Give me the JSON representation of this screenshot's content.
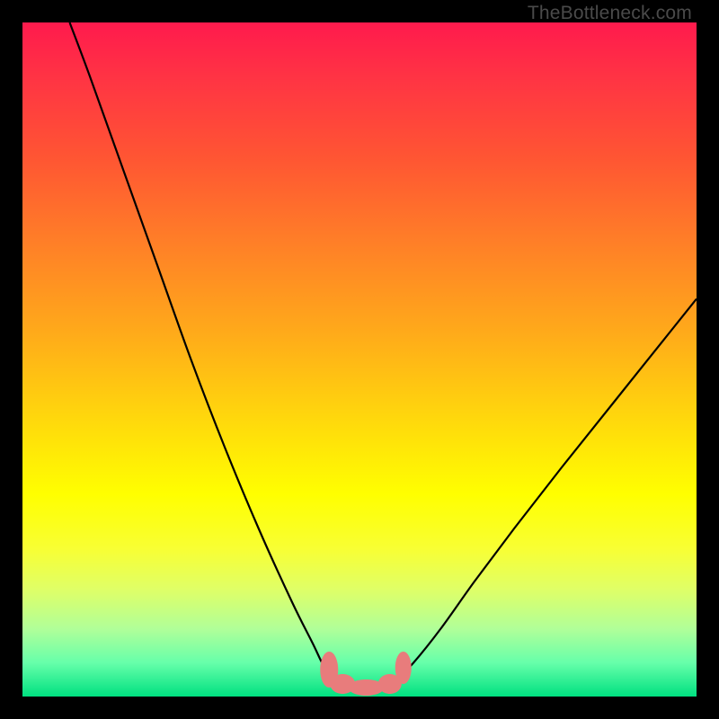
{
  "watermark": "TheBottleneck.com",
  "colors": {
    "frame": "#000000",
    "curve": "#000000",
    "blob": "#e87c7c",
    "gradient_top": "#ff1a4d",
    "gradient_bottom": "#00e080"
  },
  "chart_data": {
    "type": "line",
    "title": "",
    "xlabel": "",
    "ylabel": "",
    "xlim": [
      0,
      100
    ],
    "ylim": [
      0,
      100
    ],
    "series": [
      {
        "name": "left-curve",
        "x": [
          7,
          10,
          15,
          20,
          25,
          30,
          35,
          40,
          43,
          45,
          47
        ],
        "y": [
          100,
          92,
          78,
          64,
          50,
          37,
          25,
          14,
          8,
          4,
          2
        ]
      },
      {
        "name": "right-curve",
        "x": [
          55,
          58,
          62,
          67,
          73,
          80,
          88,
          96,
          100
        ],
        "y": [
          2,
          5,
          10,
          17,
          25,
          34,
          44,
          54,
          59
        ]
      }
    ],
    "annotations": [
      {
        "name": "bottom-blob",
        "x_range": [
          44,
          57
        ],
        "y_range": [
          0,
          4
        ]
      }
    ]
  }
}
